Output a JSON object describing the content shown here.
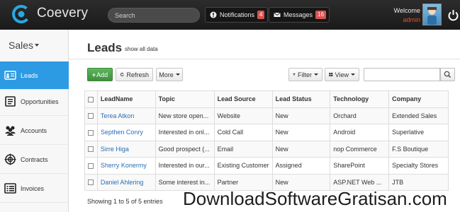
{
  "app": {
    "name": "Coevery"
  },
  "topbar": {
    "search_placeholder": "Search",
    "notifications": {
      "label": "Notifications",
      "count": "4"
    },
    "messages": {
      "label": "Messages",
      "count": "16"
    },
    "welcome": "Welcome",
    "user": "admin"
  },
  "sidebar": {
    "title": "Sales",
    "items": [
      {
        "label": "Leads",
        "icon": "id-card-icon"
      },
      {
        "label": "Opportunities",
        "icon": "document-icon"
      },
      {
        "label": "Accounts",
        "icon": "people-icon"
      },
      {
        "label": "Contracts",
        "icon": "target-icon"
      },
      {
        "label": "Invoices",
        "icon": "invoice-list-icon"
      }
    ]
  },
  "page": {
    "title": "Leads",
    "subtitle": "show all data"
  },
  "toolbar": {
    "add_label": "Add",
    "refresh_label": "Refresh",
    "more_label": "More",
    "filter_label": "Filter",
    "view_label": "View",
    "search_value": ""
  },
  "table": {
    "headers": [
      "LeadName",
      "Topic",
      "Lead Source",
      "Lead Status",
      "Technology",
      "Company"
    ],
    "rows": [
      [
        "Terea Atkon",
        "New store open...",
        "Website",
        "New",
        "Orchard",
        "Extended Sales"
      ],
      [
        "Septhen Conry",
        "Interested in onl...",
        "Cold Call",
        "New",
        "Android",
        "Superlative"
      ],
      [
        "Sirre Higa",
        "Good prospect (...",
        "Email",
        "New",
        "nop Commerce",
        "F.S Boutique"
      ],
      [
        "Sherry Konermy",
        "Interested in our...",
        "Existing Customer",
        "Assigned",
        "SharePoint",
        "Specialty Stores"
      ],
      [
        "Daniel Ahlering",
        "Some interest in...",
        "Partner",
        "New",
        "ASP.NET Web ...",
        "JTB"
      ]
    ]
  },
  "footer": {
    "entries": "Showing 1 to 5 of 5 entries"
  },
  "watermark": "DownloadSoftwareGratisan.com",
  "colors": {
    "accent": "#2d9be4",
    "badge": "#d9534f",
    "add_button": "#4cae4c",
    "user_name": "#e0542f"
  }
}
